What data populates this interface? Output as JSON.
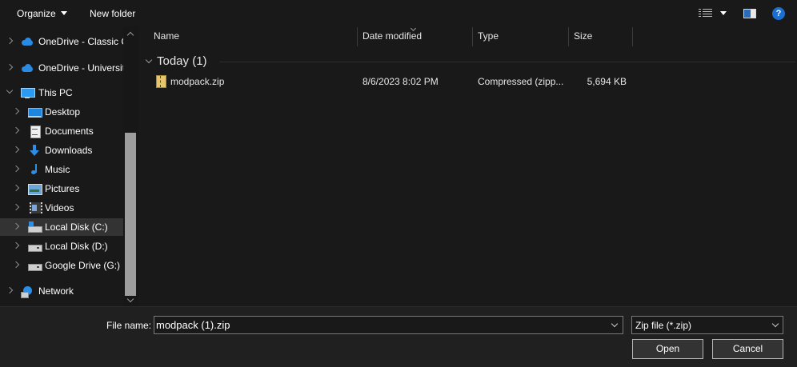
{
  "toolbar": {
    "organize_label": "Organize",
    "new_folder_label": "New folder",
    "help_label": "?"
  },
  "nav": {
    "items": [
      {
        "label": "OneDrive - Classic C",
        "icon": "onedrive-cloud-icon"
      },
      {
        "label": "OneDrive - Universit",
        "icon": "onedrive-cloud-icon"
      },
      {
        "label": "This PC",
        "icon": "this-pc-icon"
      },
      {
        "label": "Desktop",
        "icon": "desktop-icon"
      },
      {
        "label": "Documents",
        "icon": "documents-icon"
      },
      {
        "label": "Downloads",
        "icon": "downloads-icon"
      },
      {
        "label": "Music",
        "icon": "music-icon"
      },
      {
        "label": "Pictures",
        "icon": "pictures-icon"
      },
      {
        "label": "Videos",
        "icon": "videos-icon"
      },
      {
        "label": "Local Disk (C:)",
        "icon": "drive-c-icon",
        "selected": true
      },
      {
        "label": "Local Disk (D:)",
        "icon": "drive-icon"
      },
      {
        "label": "Google Drive (G:)",
        "icon": "drive-icon"
      },
      {
        "label": "Network",
        "icon": "network-icon"
      }
    ]
  },
  "list": {
    "columns": [
      "Name",
      "Date modified",
      "Type",
      "Size"
    ],
    "group_label": "Today (1)",
    "files": [
      {
        "name": "modpack.zip",
        "date": "8/6/2023 8:02 PM",
        "type": "Compressed (zipp...",
        "size": "5,694 KB"
      }
    ]
  },
  "footer": {
    "file_name_label": "File name:",
    "file_name_value": "modpack (1).zip",
    "file_type_value": "Zip file (*.zip)",
    "open_label": "Open",
    "cancel_label": "Cancel"
  },
  "colors": {
    "background": "#191919",
    "selected_row": "#333333",
    "accent": "#2d8ee8"
  }
}
